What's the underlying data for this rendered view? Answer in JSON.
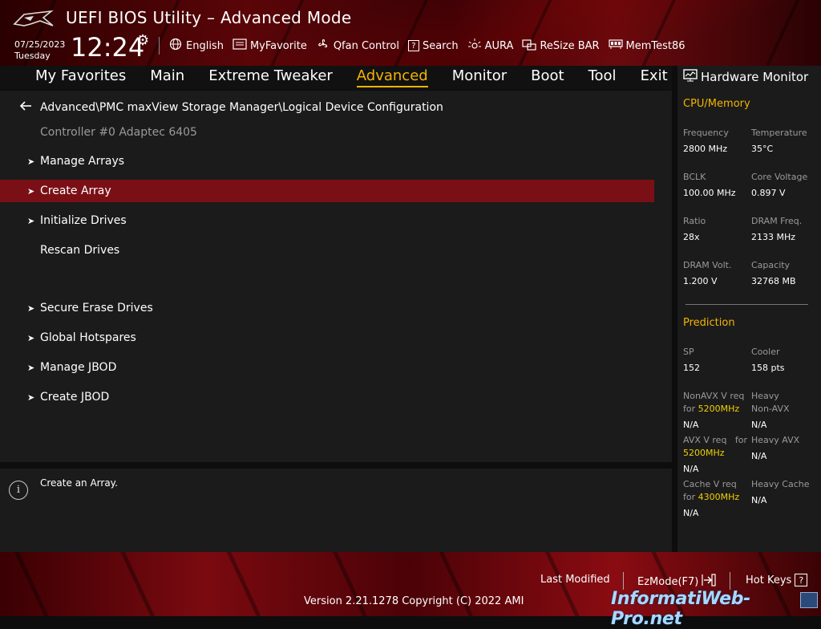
{
  "header": {
    "title": "UEFI BIOS Utility – Advanced Mode",
    "date": "07/25/2023",
    "day": "Tuesday",
    "time": "12:24",
    "toolbar": [
      {
        "icon": "globe-icon",
        "label": "English"
      },
      {
        "icon": "myfavorite-icon",
        "label": "MyFavorite"
      },
      {
        "icon": "fan-icon",
        "label": "Qfan Control"
      },
      {
        "icon": "search-help-icon",
        "label": "Search"
      },
      {
        "icon": "aura-icon",
        "label": "AURA"
      },
      {
        "icon": "resize-bar-icon",
        "label": "ReSize BAR"
      },
      {
        "icon": "memtest-icon",
        "label": "MemTest86"
      }
    ]
  },
  "menu": {
    "items": [
      "My Favorites",
      "Main",
      "Extreme Tweaker",
      "Advanced",
      "Monitor",
      "Boot",
      "Tool",
      "Exit"
    ],
    "active": "Advanced"
  },
  "main": {
    "breadcrumb": "Advanced\\PMC maxView Storage Manager\\Logical Device Configuration",
    "controller": "Controller #0 Adaptec 6405",
    "items": [
      {
        "label": "Manage Arrays",
        "submenu": true
      },
      {
        "label": "Create Array",
        "submenu": true,
        "selected": true
      },
      {
        "label": "Initialize Drives",
        "submenu": true
      },
      {
        "label": "Rescan Drives",
        "submenu": false
      },
      {
        "label": "Secure Erase Drives",
        "submenu": true
      },
      {
        "label": "Global Hotspares",
        "submenu": true
      },
      {
        "label": "Manage JBOD",
        "submenu": true
      },
      {
        "label": "Create JBOD",
        "submenu": true
      }
    ]
  },
  "help": {
    "text": "Create an Array."
  },
  "hardware_monitor": {
    "title": "Hardware Monitor",
    "cpu_memory": {
      "section": "CPU/Memory",
      "frequency_label": "Frequency",
      "frequency": "2800 MHz",
      "temperature_label": "Temperature",
      "temperature": "35°C",
      "bclk_label": "BCLK",
      "bclk": "100.00 MHz",
      "core_voltage_label": "Core Voltage",
      "core_voltage": "0.897 V",
      "ratio_label": "Ratio",
      "ratio": "28x",
      "dram_freq_label": "DRAM Freq.",
      "dram_freq": "2133 MHz",
      "dram_volt_label": "DRAM Volt.",
      "dram_volt": "1.200 V",
      "capacity_label": "Capacity",
      "capacity": "32768 MB"
    },
    "prediction": {
      "section": "Prediction",
      "sp_label": "SP",
      "sp": "152",
      "cooler_label": "Cooler",
      "cooler": "158 pts",
      "nonavx_label_a": "NonAVX V req",
      "nonavx_label_for": "for",
      "nonavx_freq": "5200MHz",
      "nonavx_value": "N/A",
      "heavy_nonavx_label_a": "Heavy",
      "heavy_nonavx_label_b": "Non-AVX",
      "heavy_nonavx_value": "N/A",
      "avx_label_a": "AVX V req",
      "avx_label_for": "for",
      "avx_freq": "5200MHz",
      "avx_value": "N/A",
      "heavy_avx_label": "Heavy AVX",
      "heavy_avx_value": "N/A",
      "cache_label_a": "Cache V req",
      "cache_label_for": "for",
      "cache_freq": "4300MHz",
      "cache_value": "N/A",
      "heavy_cache_label": "Heavy Cache",
      "heavy_cache_value": "N/A"
    }
  },
  "footer": {
    "last_modified": "Last Modified",
    "ezmode": "EzMode(F7)",
    "hotkeys": "Hot Keys",
    "hotkeys_key": "?",
    "version": "Version 2.21.1278 Copyright (C) 2022 AMI",
    "watermark": "InformatiWeb-Pro.net"
  },
  "colors": {
    "accent": "#f4b400",
    "selected_row": "#7a1016",
    "panel": "#1b1b1b",
    "predict_freq": "#f0d000"
  }
}
